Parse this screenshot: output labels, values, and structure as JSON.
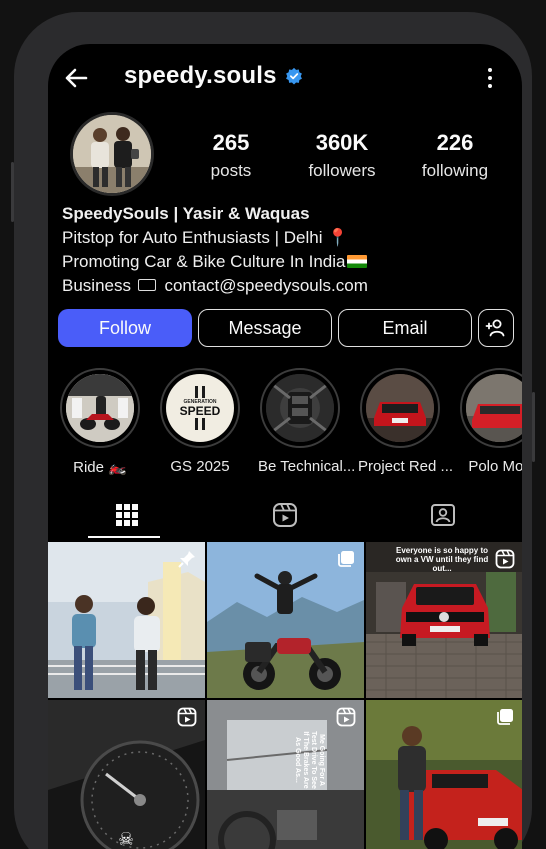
{
  "profile": {
    "username": "speedy.souls",
    "verified": true,
    "stats": [
      {
        "value": "265",
        "label": "posts"
      },
      {
        "value": "360K",
        "label": "followers"
      },
      {
        "value": "226",
        "label": "following"
      }
    ],
    "bio": {
      "name": "SpeedySouls | Yasir & Waquas",
      "line1": "Pitstop for Auto Enthusiasts | Delhi 📍",
      "line2": "Promoting Car & Bike Culture In India",
      "line3_prefix": "Business",
      "line3_email": "contact@speedysouls.com"
    }
  },
  "actions": {
    "follow": "Follow",
    "message": "Message",
    "email": "Email"
  },
  "highlights": [
    {
      "label": "Ride 🏍️"
    },
    {
      "label": "GS 2025",
      "text_top": "GENERATION",
      "text_main": "SPEED"
    },
    {
      "label": "Be Technical..."
    },
    {
      "label": "Project Red ..."
    },
    {
      "label": "Polo Mod"
    }
  ],
  "posts": [
    {
      "type": "pinned"
    },
    {
      "type": "carousel"
    },
    {
      "type": "reel",
      "caption": "Everyone is so happy to own a VW until they find out..."
    },
    {
      "type": "reel"
    },
    {
      "type": "reel",
      "caption": "Me Going For A Test Drive To See If The Brakes Are As Good As..."
    },
    {
      "type": "carousel"
    }
  ],
  "colors": {
    "accent": "#4a5df9",
    "verified": "#3897f0",
    "background": "#000000"
  },
  "icons": [
    "back-arrow-icon",
    "verified-badge-icon",
    "more-vertical-icon",
    "add-user-icon",
    "grid-icon",
    "reels-icon",
    "tagged-icon",
    "pin-icon",
    "carousel-icon",
    "reel-icon"
  ]
}
